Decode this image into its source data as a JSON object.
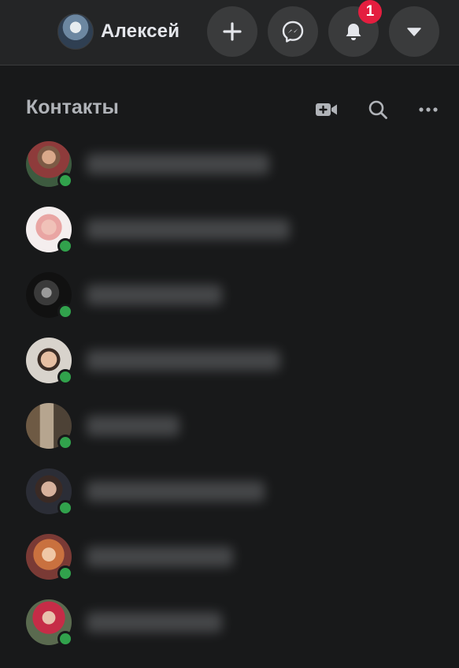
{
  "header": {
    "user_name": "Алексей",
    "notifications_badge": "1",
    "buttons": [
      "create",
      "messenger",
      "notifications",
      "account-menu"
    ]
  },
  "contacts": {
    "title": "Контакты",
    "icons": [
      "video-plus-icon",
      "search-icon",
      "more-icon"
    ],
    "items": [
      {
        "avatar": "contact-avatar-1",
        "online": true
      },
      {
        "avatar": "contact-avatar-2",
        "online": true
      },
      {
        "avatar": "contact-avatar-3",
        "online": true
      },
      {
        "avatar": "contact-avatar-4",
        "online": true
      },
      {
        "avatar": "contact-avatar-5",
        "online": true
      },
      {
        "avatar": "contact-avatar-6",
        "online": true
      },
      {
        "avatar": "contact-avatar-7",
        "online": true
      },
      {
        "avatar": "contact-avatar-8",
        "online": true
      }
    ]
  },
  "colors": {
    "background": "#18191a",
    "topbar": "#242526",
    "button": "#3a3b3c",
    "badge": "#e41e3f",
    "online": "#31a24c",
    "text_primary": "#e4e6eb",
    "text_secondary": "#b0b3b8"
  }
}
